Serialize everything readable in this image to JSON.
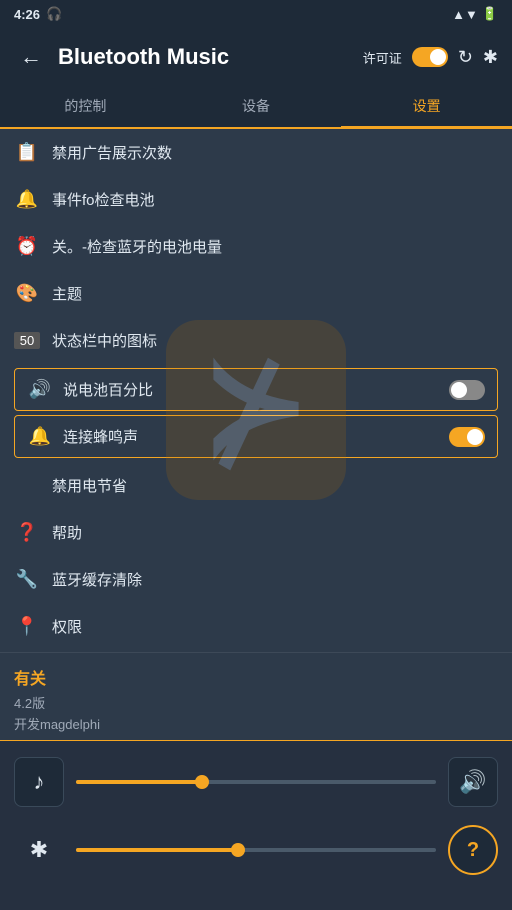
{
  "status": {
    "time": "4:26",
    "headphones_icon": "🎧",
    "signal_icon": "▲",
    "battery_icon": "🔋"
  },
  "header": {
    "back_label": "←",
    "title": "Bluetooth Music",
    "permission_label": "许可证",
    "permission_on": true,
    "refresh_icon": "↻",
    "bluetooth_icon": "⊞"
  },
  "tabs": [
    {
      "label": "的控制",
      "active": false
    },
    {
      "label": "设备",
      "active": false
    },
    {
      "label": "设置",
      "active": true
    }
  ],
  "settings": [
    {
      "icon": "📋",
      "label": "禁用广告展示次数",
      "type": "item"
    },
    {
      "icon": "🔔",
      "label": "事件fo检查电池",
      "type": "item"
    },
    {
      "icon": "⏰",
      "label": "关。-检查蓝牙的电池电量",
      "type": "item"
    },
    {
      "icon": "🎨",
      "label": "主题",
      "type": "item"
    },
    {
      "icon": "50",
      "label": "状态栏中的图标",
      "type": "item"
    },
    {
      "icon": "🔊",
      "label": "说电池百分比",
      "type": "toggle",
      "on": false
    },
    {
      "icon": "🔔",
      "label": "连接蜂鸣声",
      "type": "toggle",
      "on": true
    },
    {
      "icon": "",
      "label": "禁用电节省",
      "type": "section"
    },
    {
      "icon": "❓",
      "label": "帮助",
      "type": "item"
    },
    {
      "icon": "🔧",
      "label": "蓝牙缓存清除",
      "type": "item"
    },
    {
      "icon": "📍",
      "label": "权限",
      "type": "item"
    }
  ],
  "about": {
    "title": "有关",
    "version": "4.2版",
    "developer": "开发magdelphi"
  },
  "player": {
    "music_icon": "♪",
    "volume_icon": "🔊",
    "bluetooth_icon": "⊁",
    "help_icon": "?",
    "slider1_percent": 35,
    "slider2_percent": 45
  }
}
